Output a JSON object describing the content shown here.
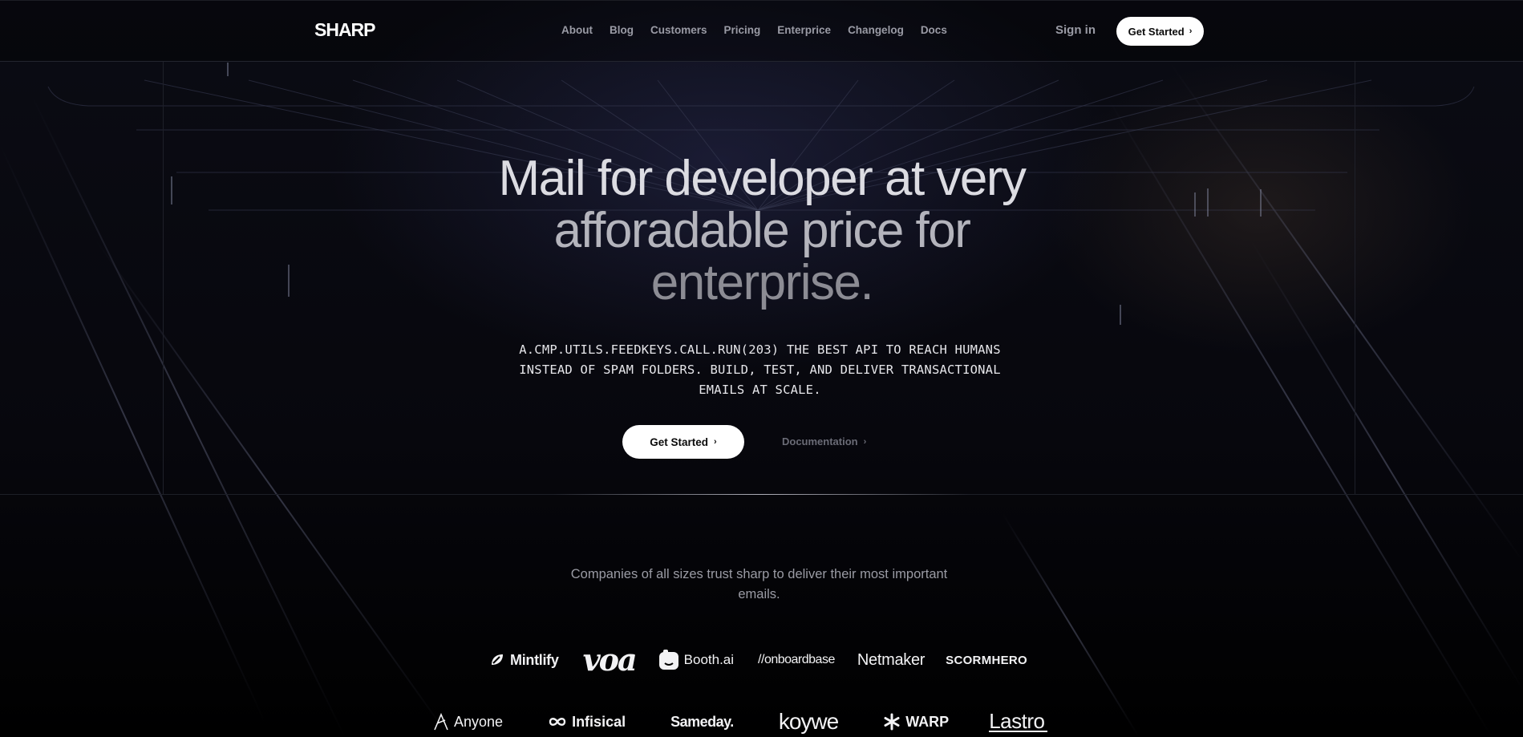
{
  "nav": {
    "brand": "SHARP",
    "links": [
      "About",
      "Blog",
      "Customers",
      "Pricing",
      "Enterprice",
      "Changelog",
      "Docs"
    ],
    "sign_in": "Sign in",
    "cta": "Get Started"
  },
  "hero": {
    "title_line1": "Mail for developer at very",
    "title_line2": "afforadable price for",
    "title_line3": "enterprise.",
    "subtitle": "A.CMP.UTILS.FEEDKEYS.CALL.RUN(203) THE BEST API TO REACH HUMANS INSTEAD OF SPAM FOLDERS. BUILD, TEST, AND DELIVER TRANSACTIONAL EMAILS AT SCALE.",
    "primary_cta": "Get Started",
    "secondary_cta": "Documentation"
  },
  "trust": {
    "text": "Companies of all sizes trust sharp to deliver their most important emails."
  },
  "logos_row1": [
    "Mintlify",
    "voa",
    "Booth.ai",
    "//onboardbase",
    "Netmaker",
    "SCORMHERO"
  ],
  "logos_row2": [
    "Anyone",
    "Infisical",
    "Sameday.",
    "koywe",
    "WARP",
    "Lastro"
  ],
  "icons": {
    "chevron": "chevron-right-icon"
  },
  "colors": {
    "background": "#000000",
    "nav_text": "#9a9ba5",
    "button_bg": "#ffffff",
    "button_text": "#0a0a0a"
  }
}
